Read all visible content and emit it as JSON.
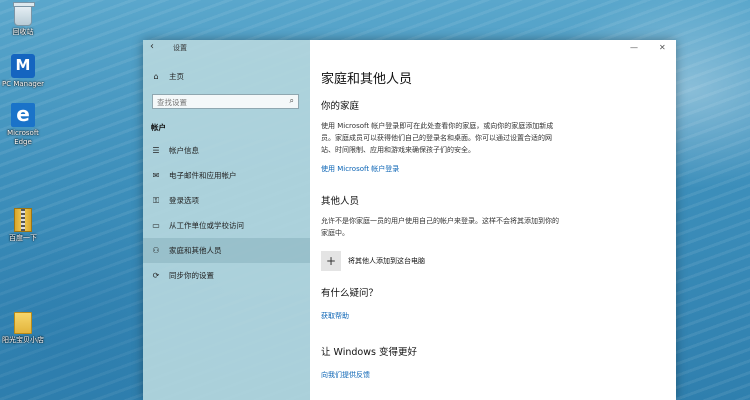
{
  "desktop": {
    "icons": [
      {
        "label": "回收站"
      },
      {
        "label": "PC Manager"
      },
      {
        "label": "Microsoft Edge"
      },
      {
        "label": "百度一下"
      },
      {
        "label": "阳光宝贝小店"
      }
    ]
  },
  "window": {
    "app_title": "设置",
    "controls": {
      "minimize": "—",
      "close": "✕"
    },
    "sidebar": {
      "home_label": "主页",
      "search_placeholder": "查找设置",
      "section_header": "帐户",
      "items": [
        {
          "label": "帐户信息",
          "icon": "person-card-icon"
        },
        {
          "label": "电子邮件和应用帐户",
          "icon": "mail-icon"
        },
        {
          "label": "登录选项",
          "icon": "key-icon"
        },
        {
          "label": "从工作单位或学校访问",
          "icon": "briefcase-icon"
        },
        {
          "label": "家庭和其他人员",
          "icon": "people-icon"
        },
        {
          "label": "同步你的设置",
          "icon": "sync-icon"
        }
      ],
      "active_index": 4
    },
    "content": {
      "page_title": "家庭和其他人员",
      "family": {
        "heading": "你的家庭",
        "description": "使用 Microsoft 帐户登录即可在此处查看你的家庭，或向你的家庭添加新成员。家庭成员可以获得他们自己的登录名和桌面。你可以通过设置合适的网站、时间限制、应用和游戏来确保孩子们的安全。",
        "link": "使用 Microsoft 帐户登录"
      },
      "others": {
        "heading": "其他人员",
        "description": "允许不是你家庭一员的用户使用自己的帐户来登录。这样不会将其添加到你的家庭中。",
        "add_label": "将其他人添加到这台电脑"
      },
      "questions": {
        "heading": "有什么疑问？",
        "link": "获取帮助"
      },
      "feedback": {
        "heading": "让 Windows 变得更好",
        "link": "向我们提供反馈"
      }
    }
  }
}
